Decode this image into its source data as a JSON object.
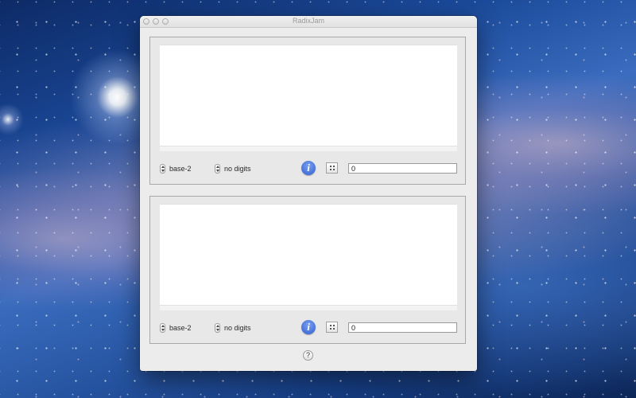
{
  "window": {
    "title": "RadixJam"
  },
  "panels": [
    {
      "base_label": "base-2",
      "digits_label": "no digits",
      "info_icon": "info-icon",
      "grid_icon": "grid-icon",
      "value": "0"
    },
    {
      "base_label": "base-2",
      "digits_label": "no digits",
      "info_icon": "info-icon",
      "grid_icon": "grid-icon",
      "value": "0"
    }
  ],
  "help": {
    "label": "?"
  },
  "colors": {
    "accent": "#3a66d6",
    "window_bg": "#ececec"
  }
}
